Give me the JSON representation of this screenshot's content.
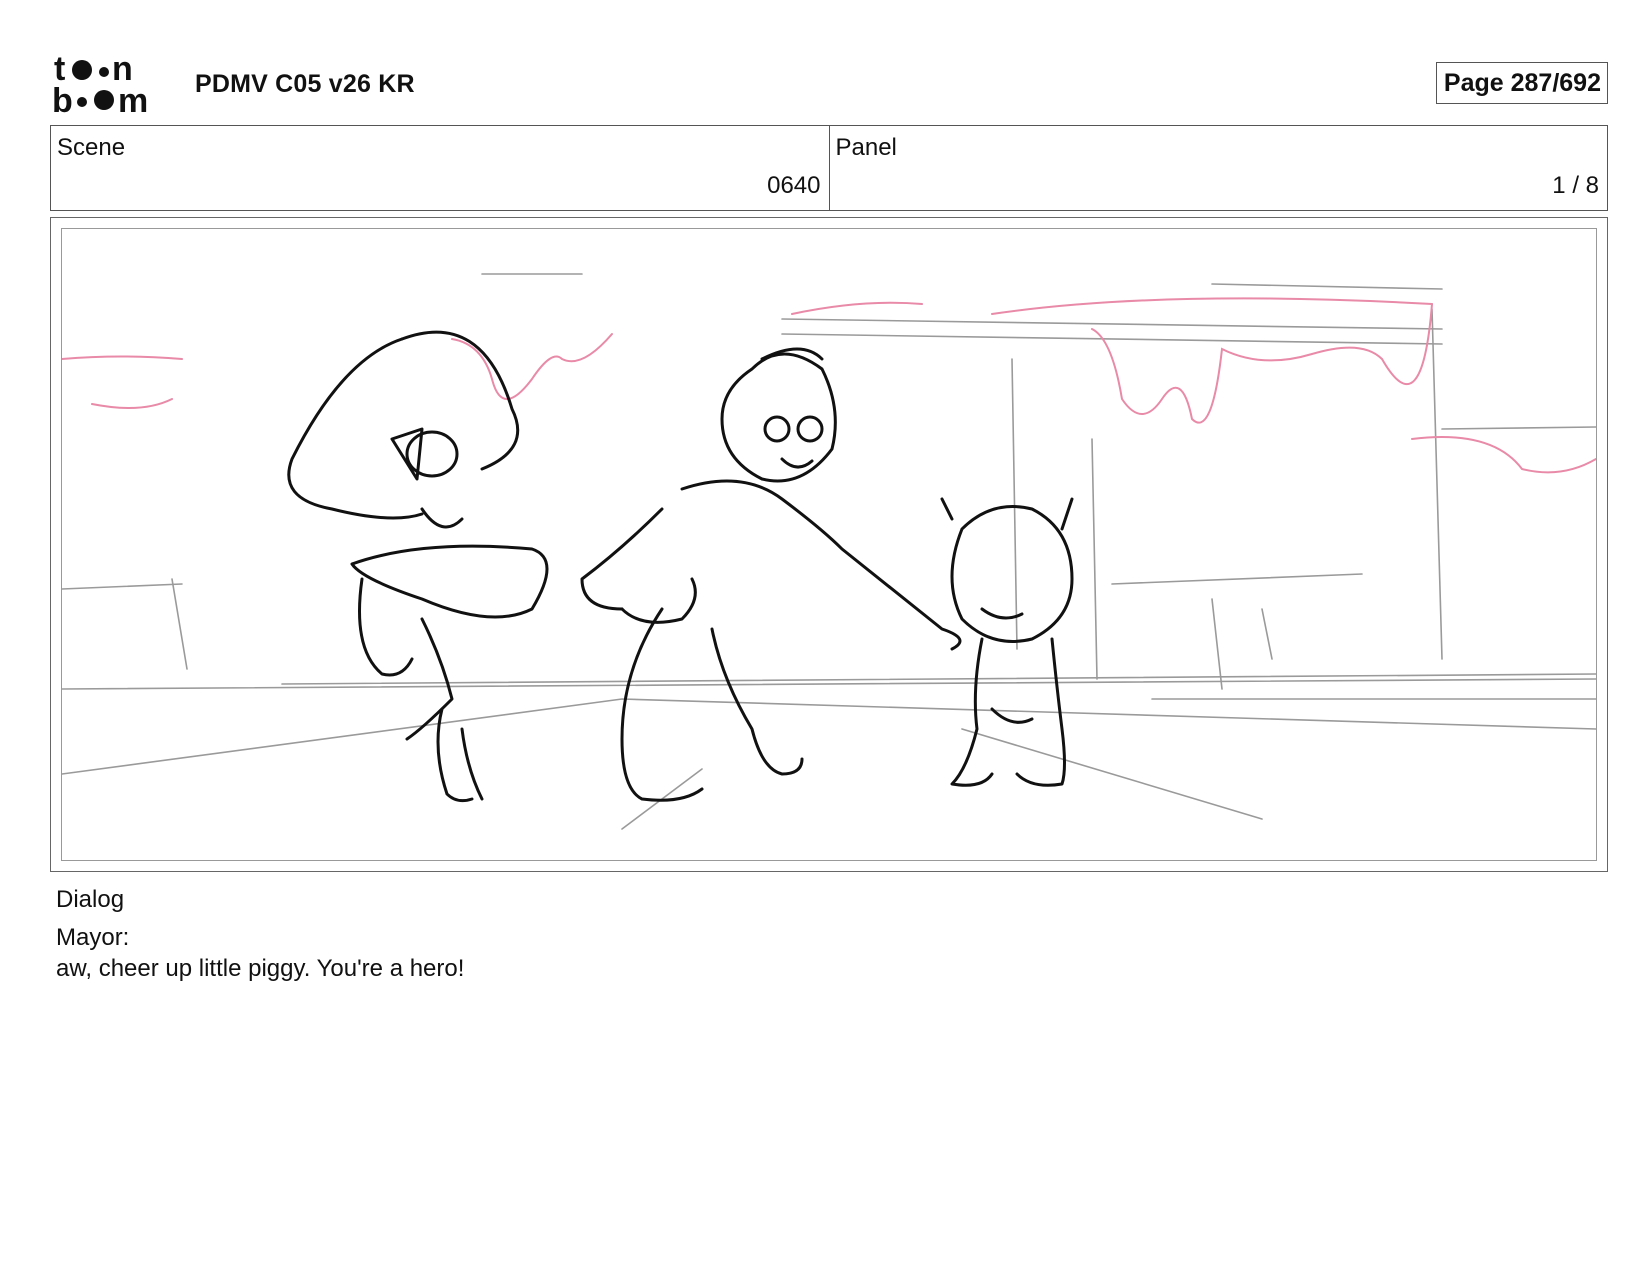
{
  "header": {
    "logo_alt": "toon boom",
    "document_title": "PDMV C05 v26 KR",
    "page_indicator": "Page 287/692"
  },
  "info": {
    "scene_label": "Scene",
    "scene_value": "0640",
    "panel_label": "Panel",
    "panel_value": "1 / 8"
  },
  "colors": {
    "sketch_line": "#111111",
    "background_line": "#9a9a9a",
    "accent_pink": "#e88aa8"
  },
  "dialog": {
    "label": "Dialog",
    "speaker": "Mayor:",
    "line": "aw, cheer up little piggy. You're a hero!"
  }
}
